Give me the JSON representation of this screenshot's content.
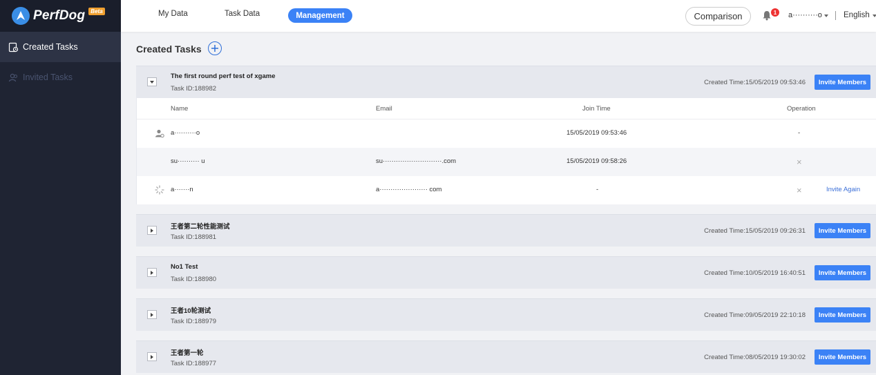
{
  "brand": {
    "name": "PerfDog",
    "badge": "Beta"
  },
  "sidebar": {
    "items": [
      {
        "label": "Created Tasks",
        "icon": "task-list-icon",
        "active": true
      },
      {
        "label": "Invited Tasks",
        "icon": "people-icon",
        "active": false
      }
    ]
  },
  "header": {
    "nav": [
      {
        "label": "My Data"
      },
      {
        "label": "Task Data"
      },
      {
        "label": "Management",
        "active": true
      }
    ],
    "comparison_label": "Comparison",
    "notification_count": "1",
    "user": "a··········o",
    "language": "English"
  },
  "main": {
    "title": "Created Tasks",
    "tasks": [
      {
        "name": "The first round perf test of xgame",
        "id": "Task ID:188982",
        "time": "Created Time:15/05/2019 09:53:46",
        "invite_label": "Invite Members",
        "expanded": true
      },
      {
        "name": "王者第二轮性能测试",
        "id": "Task ID:188981",
        "time": "Created Time:15/05/2019 09:26:31",
        "invite_label": "Invite Members"
      },
      {
        "name": "No1 Test",
        "id": "Task ID:188980",
        "time": "Created Time:10/05/2019 16:40:51",
        "invite_label": "Invite Members"
      },
      {
        "name": "王者10轮测试",
        "id": "Task ID:188979",
        "time": "Created Time:09/05/2019 22:10:18",
        "invite_label": "Invite Members"
      },
      {
        "name": "王者第一轮",
        "id": "Task ID:188977",
        "time": "Created Time:08/05/2019 19:30:02",
        "invite_label": "Invite Members"
      }
    ],
    "members": {
      "columns": [
        "Name",
        "Email",
        "Join Time",
        "Operation"
      ],
      "rows": [
        {
          "icon": "owner-icon",
          "name": "a··········o",
          "email": "",
          "join_time": "15/05/2019 09:53:46",
          "operation": "-"
        },
        {
          "icon": "",
          "name": "su·········· u",
          "email": "su···························.com",
          "join_time": "15/05/2019 09:58:26",
          "operation": "×"
        },
        {
          "icon": "loading-icon",
          "name": "a·······n",
          "email": "a······················ com",
          "join_time": "-",
          "operation": "×",
          "extra": "Invite Again"
        }
      ]
    }
  },
  "colors": {
    "accent": "#3b82f6",
    "sidebar_bg": "#1f2433",
    "header_bg": "#ffffff",
    "task_bg": "#e6e8ee"
  }
}
